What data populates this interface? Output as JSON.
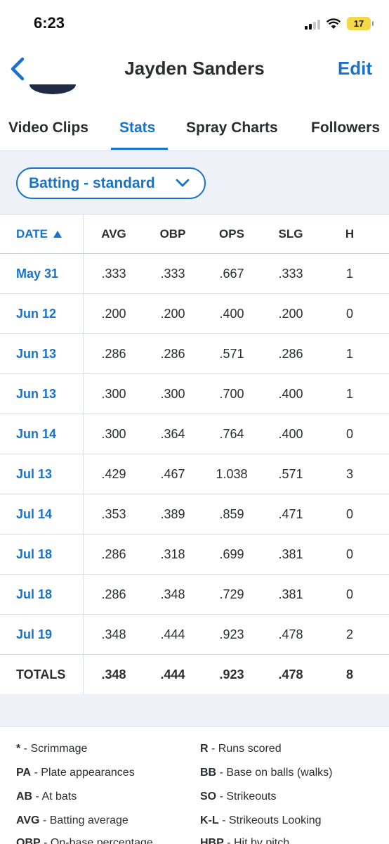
{
  "status_bar": {
    "time": "6:23",
    "battery": "17"
  },
  "nav": {
    "title": "Jayden Sanders",
    "edit_label": "Edit"
  },
  "tabs": [
    {
      "label": "Video Clips"
    },
    {
      "label": "Stats"
    },
    {
      "label": "Spray Charts"
    },
    {
      "label": "Followers"
    }
  ],
  "filter": {
    "selected": "Batting - standard"
  },
  "table": {
    "headers": {
      "date": "DATE",
      "avg": "AVG",
      "obp": "OBP",
      "ops": "OPS",
      "slg": "SLG",
      "h": "H"
    },
    "rows": [
      {
        "date": "May 31",
        "avg": ".333",
        "obp": ".333",
        "ops": ".667",
        "slg": ".333",
        "h": "1"
      },
      {
        "date": "Jun 12",
        "avg": ".200",
        "obp": ".200",
        "ops": ".400",
        "slg": ".200",
        "h": "0"
      },
      {
        "date": "Jun 13",
        "avg": ".286",
        "obp": ".286",
        "ops": ".571",
        "slg": ".286",
        "h": "1"
      },
      {
        "date": "Jun 13",
        "avg": ".300",
        "obp": ".300",
        "ops": ".700",
        "slg": ".400",
        "h": "1"
      },
      {
        "date": "Jun 14",
        "avg": ".300",
        "obp": ".364",
        "ops": ".764",
        "slg": ".400",
        "h": "0"
      },
      {
        "date": "Jul 13",
        "avg": ".429",
        "obp": ".467",
        "ops": "1.038",
        "slg": ".571",
        "h": "3"
      },
      {
        "date": "Jul 14",
        "avg": ".353",
        "obp": ".389",
        "ops": ".859",
        "slg": ".471",
        "h": "0"
      },
      {
        "date": "Jul 18",
        "avg": ".286",
        "obp": ".318",
        "ops": ".699",
        "slg": ".381",
        "h": "0"
      },
      {
        "date": "Jul 18",
        "avg": ".286",
        "obp": ".348",
        "ops": ".729",
        "slg": ".381",
        "h": "0"
      },
      {
        "date": "Jul 19",
        "avg": ".348",
        "obp": ".444",
        "ops": ".923",
        "slg": ".478",
        "h": "2"
      }
    ],
    "totals": {
      "label": "TOTALS",
      "avg": ".348",
      "obp": ".444",
      "ops": ".923",
      "slg": ".478",
      "h": "8"
    }
  },
  "legend": [
    {
      "abbr": "*",
      "desc": " - Scrimmage"
    },
    {
      "abbr": "R",
      "desc": " - Runs scored"
    },
    {
      "abbr": "PA",
      "desc": " - Plate appearances"
    },
    {
      "abbr": "BB",
      "desc": " - Base on balls (walks)"
    },
    {
      "abbr": "AB",
      "desc": " - At bats"
    },
    {
      "abbr": "SO",
      "desc": " - Strikeouts"
    },
    {
      "abbr": "AVG",
      "desc": " - Batting average"
    },
    {
      "abbr": "K-L",
      "desc": " - Strikeouts Looking"
    },
    {
      "abbr": "OBP",
      "desc": " - On-base percentage"
    },
    {
      "abbr": "HBP",
      "desc": " - Hit by pitch"
    }
  ]
}
